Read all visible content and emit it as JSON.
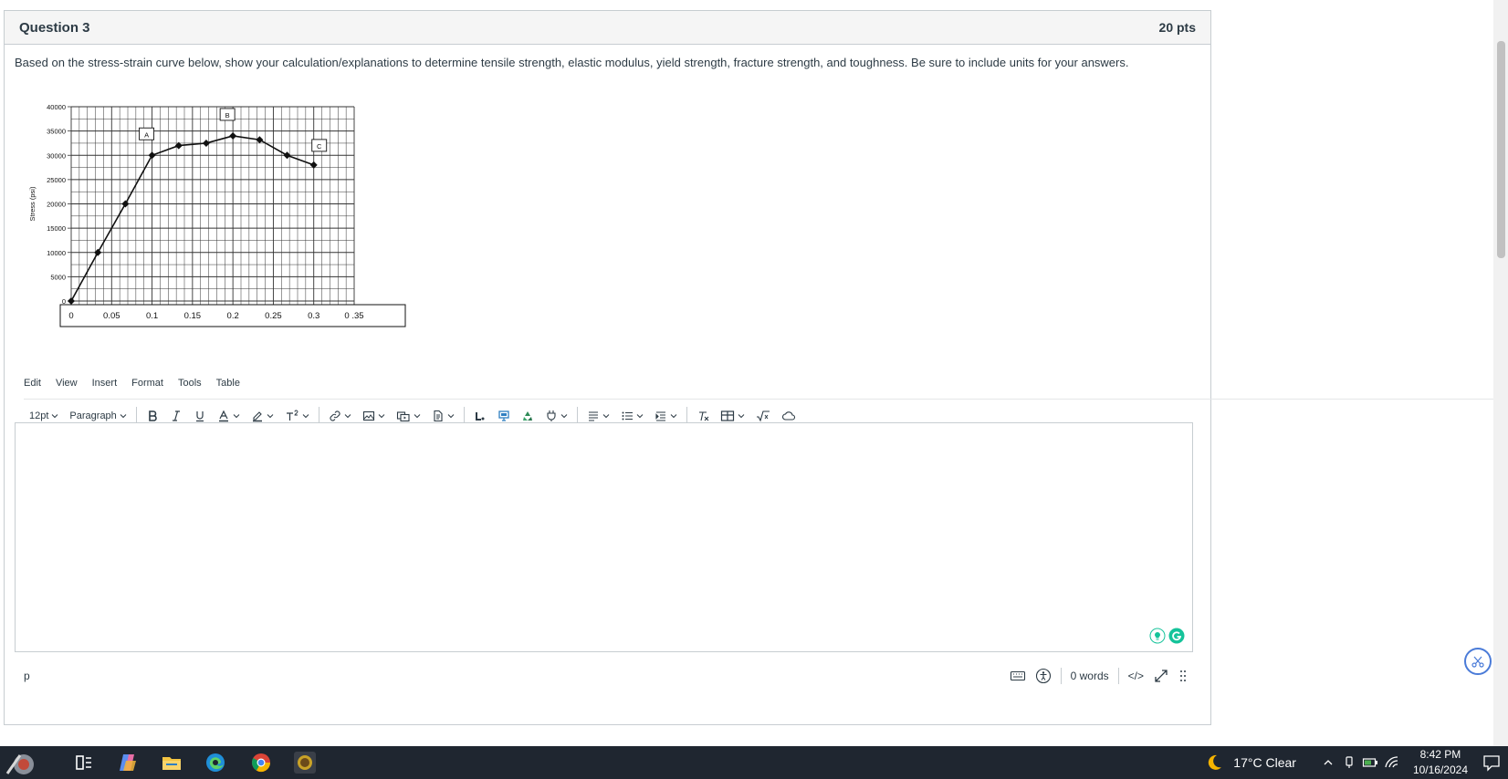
{
  "question": {
    "title": "Question 3",
    "points": "20 pts",
    "prompt": "Based on the stress-strain curve below, show your calculation/explanations to determine tensile strength, elastic modulus, yield strength, fracture strength, and toughness. Be sure to include units for your answers."
  },
  "chart_data": {
    "type": "line",
    "ylabel": "Stress (psi)",
    "xlabel": "",
    "ylim": [
      0,
      40000
    ],
    "xlim": [
      0,
      0.35
    ],
    "y_ticks": [
      "0",
      "5000",
      "10000",
      "15000",
      "20000",
      "25000",
      "30000",
      "35000",
      "40000"
    ],
    "x_ticks": [
      "0",
      "0.05",
      "0.1",
      "0.15",
      "0.2",
      "0.25",
      "0.3",
      "0 .35"
    ],
    "grid": true,
    "x": [
      0,
      0.033,
      0.067,
      0.1,
      0.133,
      0.167,
      0.2,
      0.233,
      0.267,
      0.3
    ],
    "values": [
      0,
      10000,
      20000,
      30000,
      32000,
      32500,
      34000,
      33200,
      30000,
      28000
    ],
    "annotations": [
      {
        "label": "A",
        "x": 0.1,
        "y": 30000
      },
      {
        "label": "B",
        "x": 0.2,
        "y": 34000
      },
      {
        "label": "C",
        "x": 0.3,
        "y": 28000
      }
    ]
  },
  "editor": {
    "menu": [
      "Edit",
      "View",
      "Insert",
      "Format",
      "Tools",
      "Table"
    ],
    "font_size": "12pt",
    "block_format": "Paragraph",
    "path": "p",
    "word_count": "0 words",
    "html_toggle": "</>"
  },
  "taskbar": {
    "weather": "17°C  Clear",
    "time": "8:42 PM",
    "date": "10/16/2024"
  },
  "colors": {
    "accent": "#4a7bd8",
    "grammarly": "#15c39a",
    "taskbar": "#1f2630"
  }
}
